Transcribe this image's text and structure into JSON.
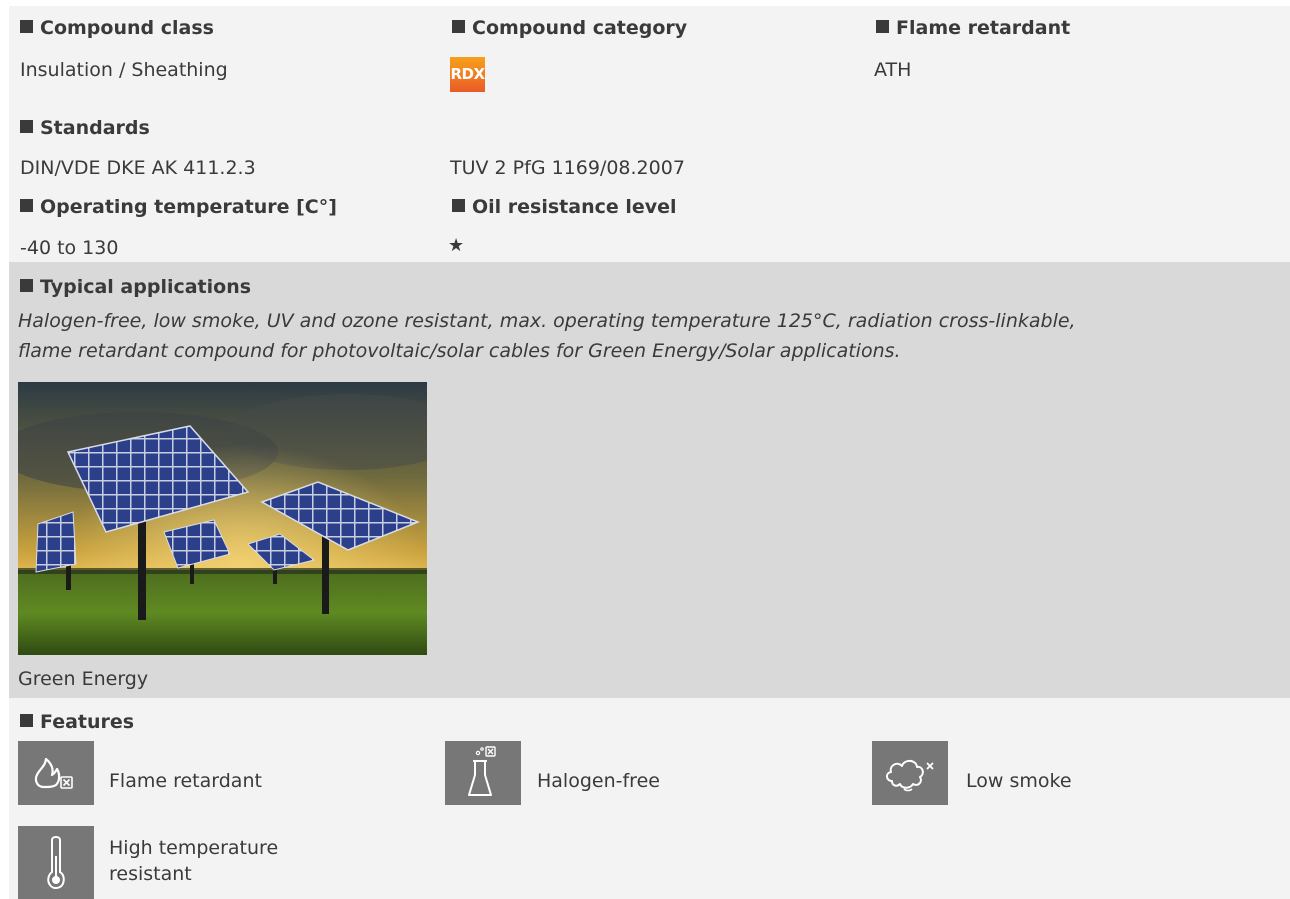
{
  "compound_class": {
    "heading": "Compound class",
    "value": "Insulation / Sheathing"
  },
  "compound_category": {
    "heading": "Compound category",
    "badge_text": "RDX",
    "badge_colors": [
      "#f7a11b",
      "#ea5a2a"
    ]
  },
  "flame_retardant": {
    "heading": "Flame retardant",
    "value": "ATH"
  },
  "standards": {
    "heading": "Standards",
    "items": [
      "DIN/VDE DKE AK 411.2.3",
      "TUV 2 PfG 1169/08.2007"
    ]
  },
  "operating_temperature": {
    "heading": "Operating temperature [C°]",
    "value": "-40 to 130"
  },
  "oil_resistance": {
    "heading": "Oil resistance level",
    "value": "★",
    "stars": 1
  },
  "typical_applications": {
    "heading": "Typical applications",
    "description_line1": "Halogen-free, low smoke, UV and ozone resistant, max. operating temperature 125°C, radiation cross-linkable,",
    "description_line2": "flame retardant compound for photovoltaic/solar cables for Green Energy/Solar applications.",
    "image_caption": "Green Energy"
  },
  "features": {
    "heading": "Features",
    "items": [
      {
        "label": "Flame retardant",
        "icon": "flame-cross-icon"
      },
      {
        "label": "Halogen-free",
        "icon": "flask-cross-icon"
      },
      {
        "label": "Low smoke",
        "icon": "smoke-cross-icon"
      },
      {
        "label_line1": "High temperature",
        "label_line2": "resistant",
        "icon": "thermometer-icon"
      }
    ]
  },
  "colors": {
    "panel_light": "#f3f3f3",
    "panel_gray": "#d9d9d9",
    "icon_tile": "#777777"
  }
}
